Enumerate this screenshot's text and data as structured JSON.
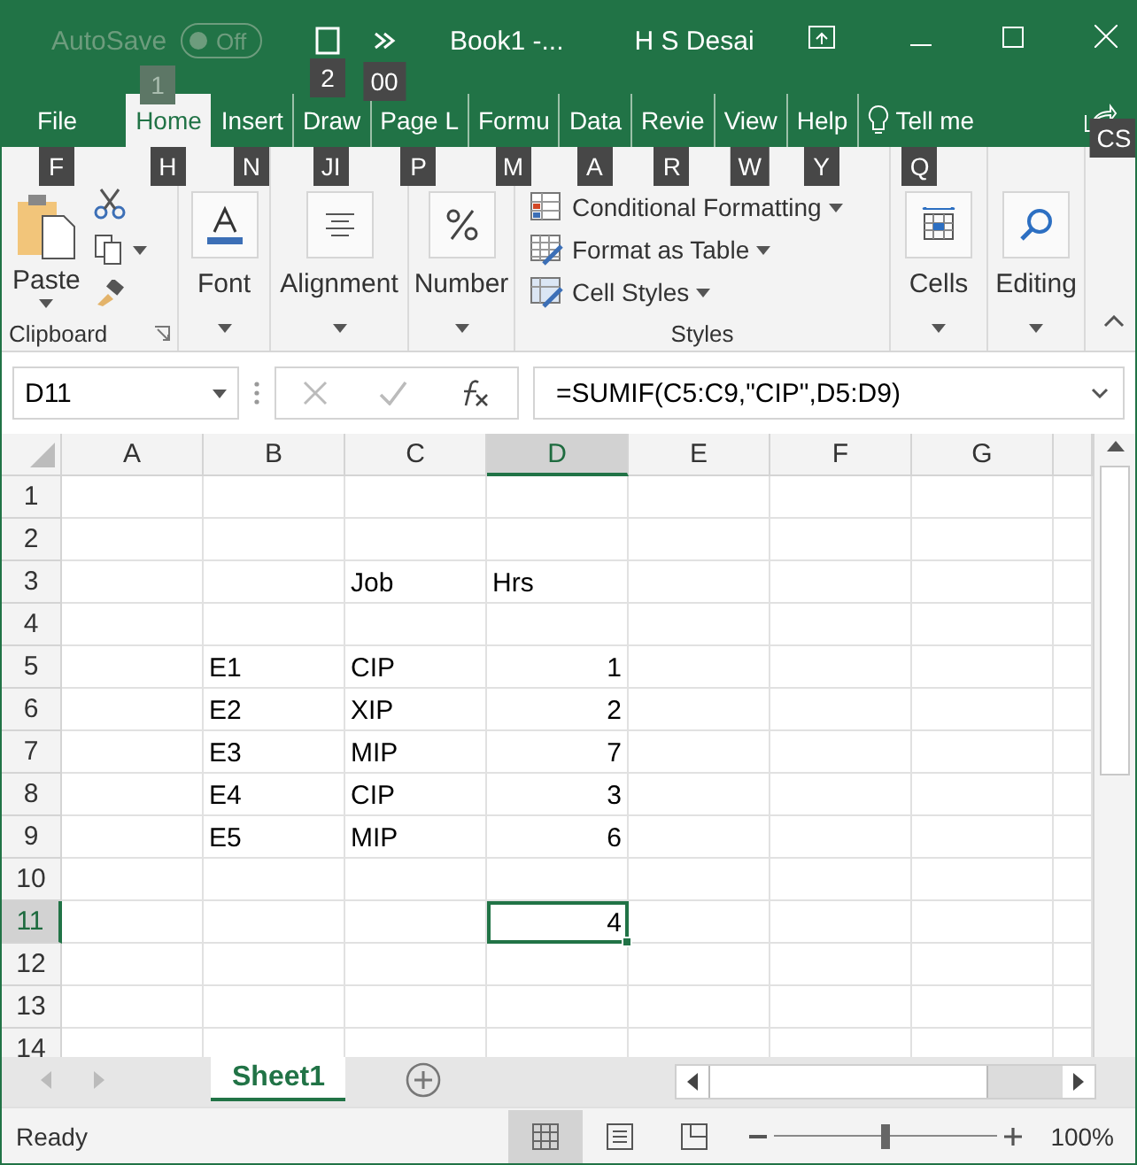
{
  "title_bar": {
    "autosave": {
      "label": "AutoSave",
      "toggle": "Off",
      "on": false,
      "disabled": true,
      "key_tip": "1"
    },
    "quick_access": [
      {
        "kind": "save",
        "key_tip": "2"
      },
      {
        "kind": "redo",
        "key_tip": "00"
      }
    ],
    "document_title": "Book1 -...",
    "user": "H S Desai"
  },
  "ribbon_tabs": [
    {
      "label": "File",
      "key_tip": "F",
      "selected": false
    },
    {
      "label": "Home",
      "key_tip": "H",
      "selected": true
    },
    {
      "label": "Insert",
      "key_tip": "N",
      "selected": false
    },
    {
      "label": "Draw",
      "key_tip": "JI",
      "selected": false
    },
    {
      "label": "Page L",
      "key_tip": "P",
      "selected": false
    },
    {
      "label": "Formu",
      "key_tip": "M",
      "selected": false
    },
    {
      "label": "Data",
      "key_tip": "A",
      "selected": false
    },
    {
      "label": "Revie",
      "key_tip": "R",
      "selected": false
    },
    {
      "label": "View",
      "key_tip": "W",
      "selected": false
    },
    {
      "label": "Help",
      "key_tip": "Y",
      "selected": false
    }
  ],
  "tell_me": {
    "label": "Tell me",
    "key_tip": "Q"
  },
  "share": {
    "key_tip": "CS"
  },
  "ribbon_groups": [
    {
      "kind": "clipboard",
      "button": "Paste",
      "label": "Clipboard"
    },
    {
      "kind": "font",
      "button": "Font"
    },
    {
      "kind": "alignment",
      "button": "Alignment"
    },
    {
      "kind": "number",
      "button": "Number"
    },
    {
      "kind": "styles",
      "items": [
        "Conditional Formatting",
        "Format as Table",
        "Cell Styles"
      ],
      "label": "Styles"
    },
    {
      "kind": "cells",
      "button": "Cells"
    },
    {
      "kind": "editing",
      "button": "Editing"
    }
  ],
  "formula_bar": {
    "name_box": "D11",
    "formula": "=SUMIF(C5:C9,\"CIP\",D5:D9)"
  },
  "columns": [
    {
      "label": "A",
      "selected": false
    },
    {
      "label": "B",
      "selected": false
    },
    {
      "label": "C",
      "selected": false
    },
    {
      "label": "D",
      "selected": true
    },
    {
      "label": "E",
      "selected": false
    },
    {
      "label": "F",
      "selected": false
    },
    {
      "label": "G",
      "selected": false
    }
  ],
  "rows": [
    {
      "label": "1",
      "selected": false
    },
    {
      "label": "2",
      "selected": false
    },
    {
      "label": "3",
      "selected": false,
      "cells": [
        {
          "kind": "empty"
        },
        {
          "kind": "empty"
        },
        {
          "kind": "text",
          "text": "Job"
        },
        {
          "kind": "text",
          "text": "Hrs"
        },
        {
          "kind": "empty"
        },
        {
          "kind": "empty"
        },
        {
          "kind": "empty"
        }
      ]
    },
    {
      "label": "4",
      "selected": false
    },
    {
      "label": "5",
      "selected": false,
      "cells": [
        {
          "kind": "empty"
        },
        {
          "kind": "text",
          "text": "E1"
        },
        {
          "kind": "text",
          "text": "CIP"
        },
        {
          "kind": "number",
          "text": "1"
        },
        {
          "kind": "empty"
        },
        {
          "kind": "empty"
        },
        {
          "kind": "empty"
        }
      ]
    },
    {
      "label": "6",
      "selected": false,
      "cells": [
        {
          "kind": "empty"
        },
        {
          "kind": "text",
          "text": "E2"
        },
        {
          "kind": "text",
          "text": "XIP"
        },
        {
          "kind": "number",
          "text": "2"
        },
        {
          "kind": "empty"
        },
        {
          "kind": "empty"
        },
        {
          "kind": "empty"
        }
      ]
    },
    {
      "label": "7",
      "selected": false,
      "cells": [
        {
          "kind": "empty"
        },
        {
          "kind": "text",
          "text": "E3"
        },
        {
          "kind": "text",
          "text": "MIP"
        },
        {
          "kind": "number",
          "text": "7"
        },
        {
          "kind": "empty"
        },
        {
          "kind": "empty"
        },
        {
          "kind": "empty"
        }
      ]
    },
    {
      "label": "8",
      "selected": false,
      "cells": [
        {
          "kind": "empty"
        },
        {
          "kind": "text",
          "text": "E4"
        },
        {
          "kind": "text",
          "text": "CIP"
        },
        {
          "kind": "number",
          "text": "3"
        },
        {
          "kind": "empty"
        },
        {
          "kind": "empty"
        },
        {
          "kind": "empty"
        }
      ]
    },
    {
      "label": "9",
      "selected": false,
      "cells": [
        {
          "kind": "empty"
        },
        {
          "kind": "text",
          "text": "E5"
        },
        {
          "kind": "text",
          "text": "MIP"
        },
        {
          "kind": "number",
          "text": "6"
        },
        {
          "kind": "empty"
        },
        {
          "kind": "empty"
        },
        {
          "kind": "empty"
        }
      ]
    },
    {
      "label": "10",
      "selected": false
    },
    {
      "label": "11",
      "selected": true,
      "cells": [
        {
          "kind": "empty"
        },
        {
          "kind": "empty"
        },
        {
          "kind": "empty"
        },
        {
          "kind": "number",
          "text": "4"
        },
        {
          "kind": "empty"
        },
        {
          "kind": "empty"
        },
        {
          "kind": "empty"
        }
      ]
    },
    {
      "label": "12",
      "selected": false
    },
    {
      "label": "13",
      "selected": false
    },
    {
      "label": "14",
      "selected": false
    }
  ],
  "sheet_tabs": [
    {
      "label": "Sheet1",
      "selected": true
    }
  ],
  "status_bar": {
    "status": "Ready",
    "views": [
      {
        "kind": "normal",
        "selected": true
      },
      {
        "kind": "page_layout",
        "selected": false
      },
      {
        "kind": "page_break",
        "selected": false
      }
    ],
    "zoom": {
      "level": 0.5,
      "label": "100%"
    }
  }
}
